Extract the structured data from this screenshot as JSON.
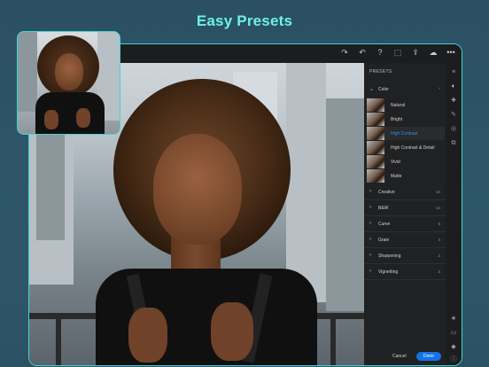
{
  "headline": "Easy Presets",
  "colors": {
    "headline": "#6ff0ea",
    "accent_blue": "#1473e6",
    "active_preset": "#2e8ef5",
    "frame": "#3fd6d6"
  },
  "toolbar": {
    "icons": [
      "redo-icon",
      "undo-icon",
      "help-icon",
      "share-icon",
      "export-icon",
      "cloud-icon",
      "more-icon"
    ],
    "glyphs": [
      "↷",
      "↶",
      "?",
      "⬚",
      "⇪",
      "☁",
      "•••"
    ]
  },
  "panel": {
    "title": "PRESETS",
    "group": {
      "label": "Color",
      "expanded": true
    },
    "presets": [
      {
        "label": "Natural",
        "active": false
      },
      {
        "label": "Bright",
        "active": false
      },
      {
        "label": "High Contrast",
        "active": true
      },
      {
        "label": "High Contrast & Detail",
        "active": false
      },
      {
        "label": "Vivid",
        "active": false
      },
      {
        "label": "Matte",
        "active": false
      }
    ],
    "sections": [
      {
        "label": "Creative",
        "count": "10"
      },
      {
        "label": "B&W",
        "count": "14"
      },
      {
        "label": "Curve",
        "count": "5"
      },
      {
        "label": "Grain",
        "count": "3"
      },
      {
        "label": "Sharpening",
        "count": "2"
      },
      {
        "label": "Vignetting",
        "count": "3"
      }
    ]
  },
  "footer": {
    "cancel_label": "Cancel",
    "done_label": "Done"
  },
  "side_rail": {
    "icons": [
      "edit-icon",
      "presets-icon",
      "heal-icon",
      "brush-icon",
      "radial-icon",
      "versions-icon",
      "star-icon",
      "comment-icon",
      "tag-icon",
      "info-icon"
    ]
  }
}
